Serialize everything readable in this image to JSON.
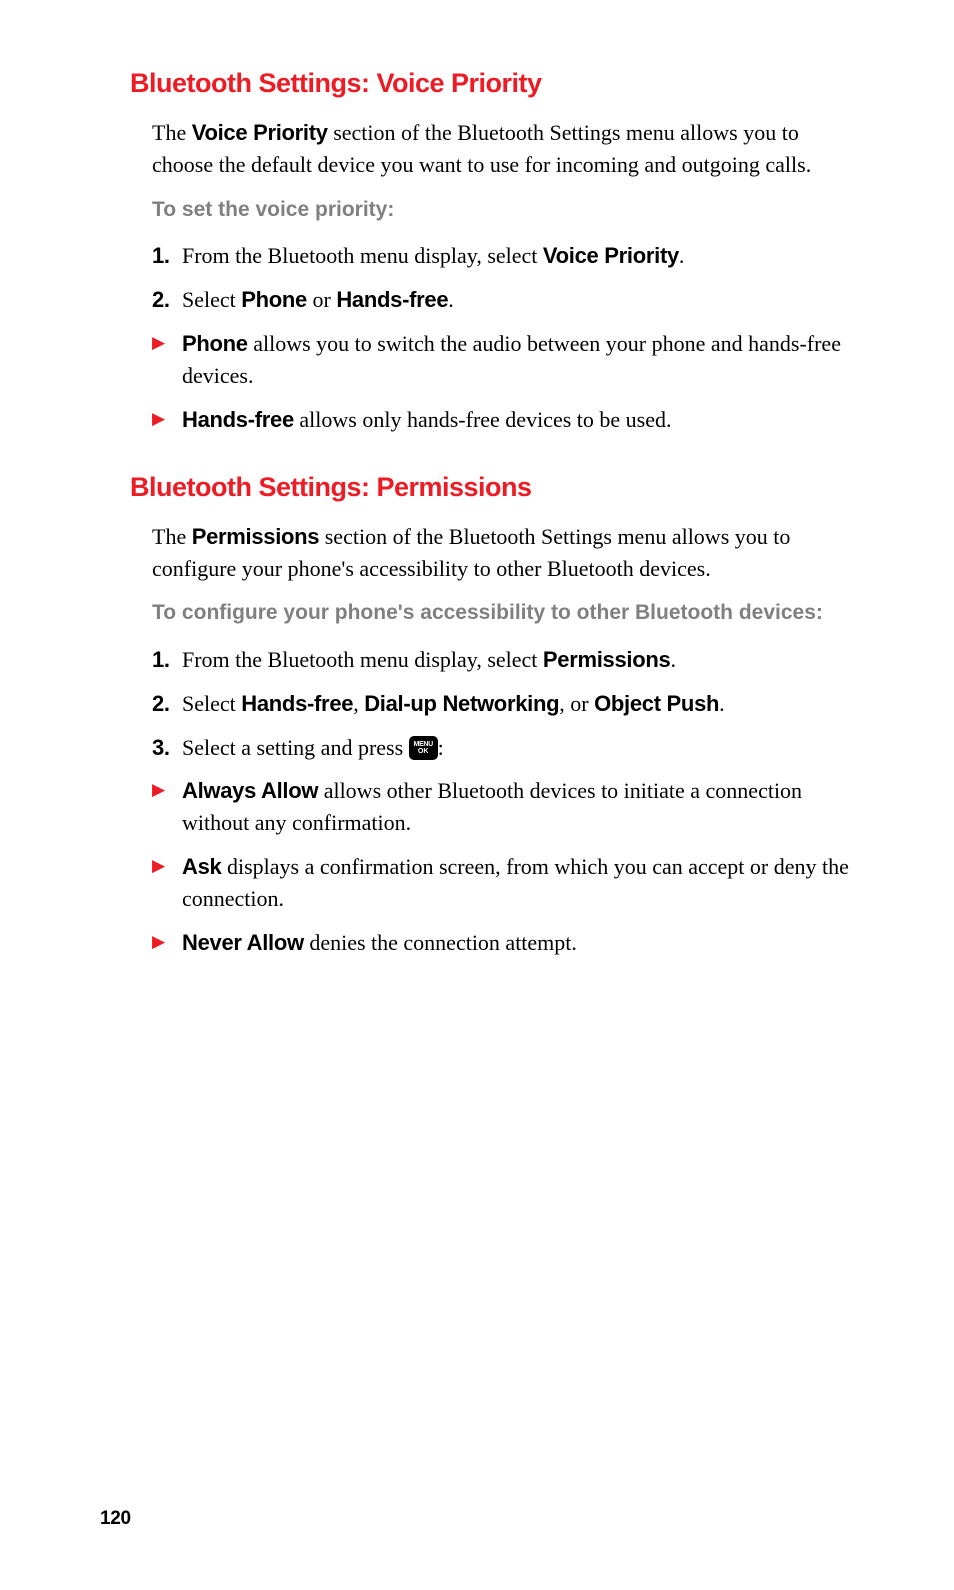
{
  "page_number": "120",
  "section1": {
    "heading": "Bluetooth Settings: Voice Priority",
    "intro_pre": "The ",
    "intro_bold": "Voice Priority",
    "intro_post": " section of the Bluetooth Settings menu allows you to choose the default device you want to use for incoming and outgoing calls.",
    "sub": "To set the voice priority:",
    "step1": {
      "num": "1.",
      "pre": "From the Bluetooth menu display, select ",
      "bold": "Voice Priority",
      "post": "."
    },
    "step2": {
      "num": "2.",
      "pre": "Select ",
      "b1": "Phone",
      "mid": " or ",
      "b2": "Hands-free",
      "post": "."
    },
    "bullet1": {
      "bold": "Phone",
      "rest": " allows you to switch the audio between your phone and hands-free devices."
    },
    "bullet2": {
      "bold": "Hands-free",
      "rest": " allows only hands-free devices to be used."
    }
  },
  "section2": {
    "heading": "Bluetooth Settings: Permissions",
    "intro_pre": "The ",
    "intro_bold": "Permissions",
    "intro_post": " section of the Bluetooth Settings menu allows you to configure your phone's accessibility to other Bluetooth devices.",
    "sub": "To configure your phone's accessibility to other Bluetooth devices:",
    "step1": {
      "num": "1.",
      "pre": "From the Bluetooth menu display, select ",
      "bold": "Permissions",
      "post": "."
    },
    "step2": {
      "num": "2.",
      "pre": "Select ",
      "b1": "Hands-free",
      "c1": ", ",
      "b2": "Dial-up Networking",
      "c2": ", or ",
      "b3": "Object Push",
      "post": "."
    },
    "step3": {
      "num": "3.",
      "pre": "Select a setting and press ",
      "post": ":"
    },
    "bullet1": {
      "bold": "Always Allow",
      "rest": " allows other Bluetooth devices to initiate a connection without any confirmation."
    },
    "bullet2": {
      "bold": "Ask",
      "rest": " displays a confirmation screen, from which you can accept or deny the connection."
    },
    "bullet3": {
      "bold": "Never Allow",
      "rest": " denies the connection attempt."
    }
  },
  "key": {
    "l1": "MENU",
    "l2": "OK"
  },
  "arrow": "▶"
}
